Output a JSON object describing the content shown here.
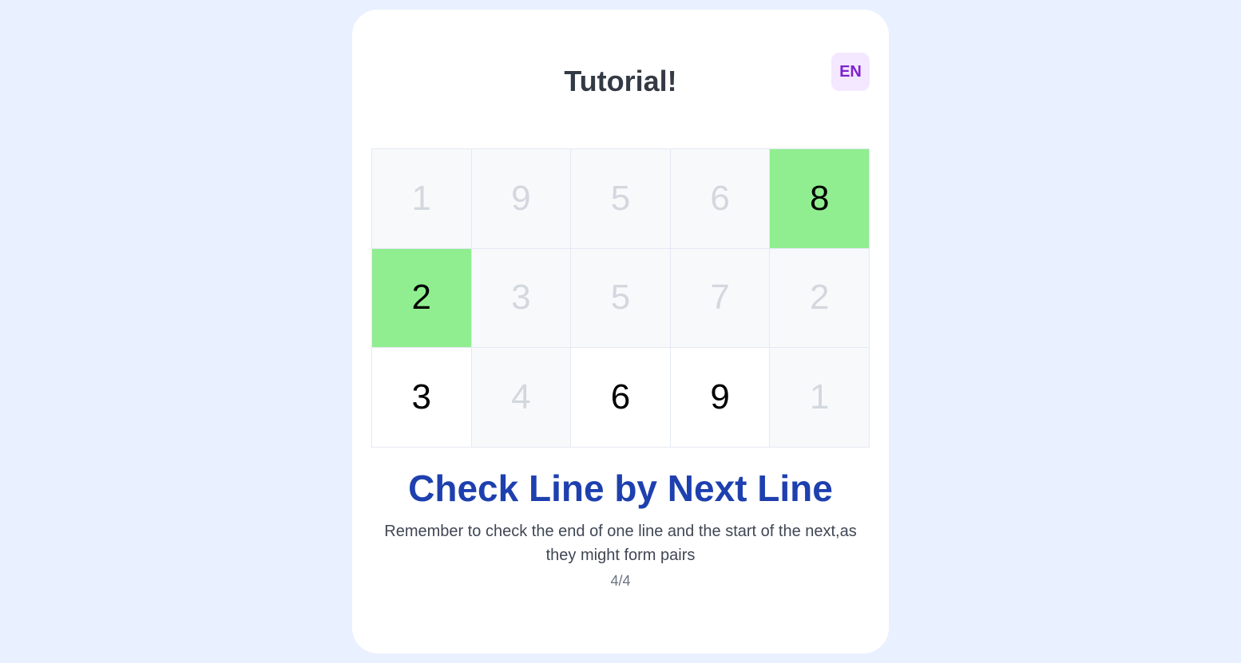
{
  "header": {
    "title": "Tutorial!",
    "language": "EN"
  },
  "grid": {
    "rows": [
      [
        {
          "value": "1",
          "state": "faded"
        },
        {
          "value": "9",
          "state": "faded"
        },
        {
          "value": "5",
          "state": "faded"
        },
        {
          "value": "6",
          "state": "faded"
        },
        {
          "value": "8",
          "state": "selected"
        }
      ],
      [
        {
          "value": "2",
          "state": "selected"
        },
        {
          "value": "3",
          "state": "faded"
        },
        {
          "value": "5",
          "state": "faded"
        },
        {
          "value": "7",
          "state": "faded"
        },
        {
          "value": "2",
          "state": "faded"
        }
      ],
      [
        {
          "value": "3",
          "state": "active"
        },
        {
          "value": "4",
          "state": "faded"
        },
        {
          "value": "6",
          "state": "active"
        },
        {
          "value": "9",
          "state": "active"
        },
        {
          "value": "1",
          "state": "faded"
        }
      ]
    ]
  },
  "tutorial": {
    "heading": "Check Line by Next Line",
    "description": "Remember to check the end of one line and the start of the next,as they might form pairs",
    "progress": "4/4"
  },
  "colors": {
    "background": "#e9f0ff",
    "selected": "#90ee90",
    "heading": "#1e40af",
    "lang_bg": "#f3e8ff",
    "lang_text": "#7e22ce"
  }
}
